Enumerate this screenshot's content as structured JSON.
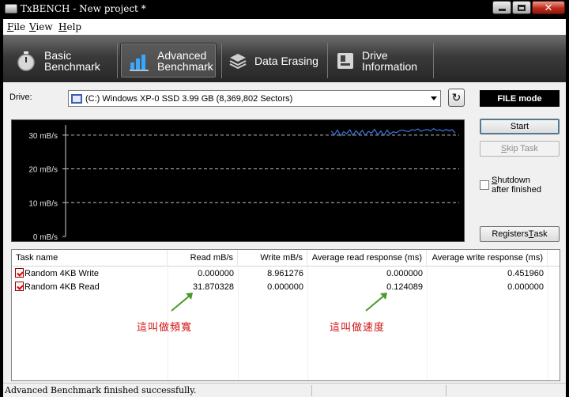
{
  "window": {
    "title": "TxBENCH - New project *"
  },
  "menu": {
    "items": [
      {
        "label_ul": "F",
        "label_rest": "ile"
      },
      {
        "label_ul": "V",
        "label_rest": "iew"
      },
      {
        "label_ul": "H",
        "label_rest": "elp"
      }
    ]
  },
  "tabs": [
    {
      "line1": "Basic",
      "line2": "Benchmark",
      "icon": "stopwatch-icon",
      "active": false
    },
    {
      "line1": "Advanced",
      "line2": "Benchmark",
      "icon": "bar-chart-icon",
      "active": true
    },
    {
      "line1": "Data Erasing",
      "line2": "",
      "icon": "eraser-icon",
      "active": false
    },
    {
      "line1": "Drive",
      "line2": "Information",
      "icon": "drive-info-icon",
      "active": false
    }
  ],
  "drive": {
    "label": "Drive:",
    "selected": "(C:) Windows XP-0 SSD  3.99 GB (8,369,802 Sectors)"
  },
  "mode": "FILE mode",
  "buttons": {
    "start": "Start",
    "skip_ul": "S",
    "skip_rest": "kip Task",
    "register_pre": "Registers ",
    "register_ul": "T",
    "register_post": "ask"
  },
  "shutdown": {
    "line1_ul": "S",
    "line1_rest": "hutdown",
    "line2": "after finished",
    "checked": false
  },
  "chart_data": {
    "type": "line",
    "title": "",
    "xlabel": "",
    "ylabel": "",
    "ylim": [
      0,
      33
    ],
    "yticks": [
      "0 mB/s",
      "10 mB/s",
      "20 mB/s",
      "30 mB/s"
    ],
    "ytick_values": [
      0,
      10,
      20,
      30
    ],
    "grid": "dashed horizontal",
    "series": [
      {
        "color": "#3a78e0",
        "x_range": [
          0.675,
          0.99
        ],
        "values": [
          31.2,
          30.1,
          31.5,
          29.8,
          31.0,
          30.4,
          31.6,
          29.9,
          31.3,
          30.2,
          31.4,
          30.0,
          31.1,
          30.6,
          31.7,
          30.1,
          31.2,
          29.9,
          31.5,
          30.3,
          31.0,
          30.7,
          31.3,
          31.5,
          31.2,
          31.0,
          31.6,
          31.4,
          31.8,
          31.1,
          31.5,
          31.7,
          31.2,
          31.9,
          31.4,
          31.6,
          31.2,
          31.7,
          31.3,
          31.6,
          30.6
        ]
      }
    ]
  },
  "table": {
    "headers": [
      "Task name",
      "Read mB/s",
      "Write mB/s",
      "Average read response (ms)",
      "Average write response (ms)"
    ],
    "rows": [
      [
        "Random 4KB Write",
        "0.000000",
        "8.961276",
        "0.000000",
        "0.451960"
      ],
      [
        "Random 4KB Read",
        "31.870328",
        "0.000000",
        "0.124089",
        "0.000000"
      ]
    ]
  },
  "annotations": [
    "這叫做頻寬",
    "這叫做速度"
  ],
  "status": "Advanced Benchmark finished successfully."
}
